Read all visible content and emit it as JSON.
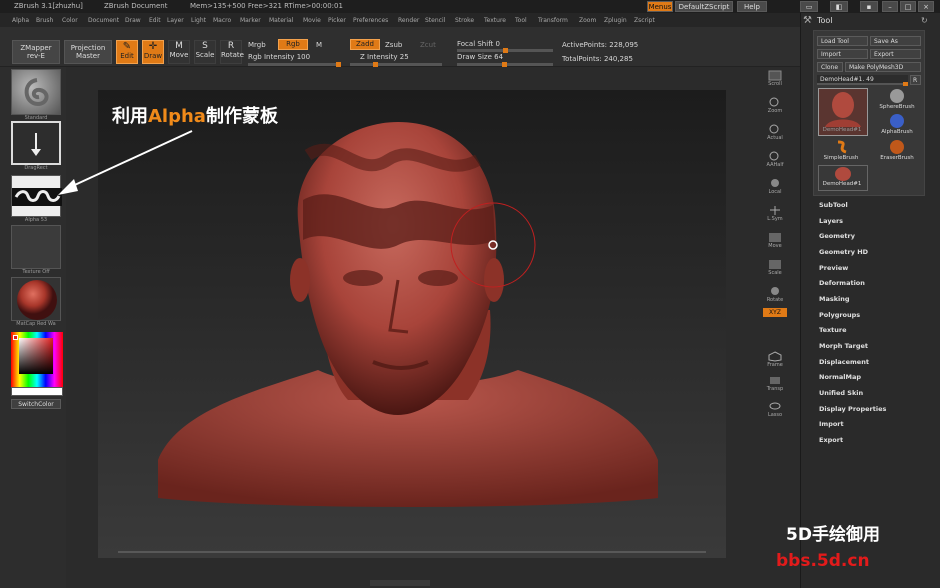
{
  "titlebar": {
    "app": "ZBrush 3.1[zhuzhu]",
    "document": "ZBrush Document",
    "stats": "Mem>135+500 Free>321 RTime>00:00:01",
    "menus_btn": "Menus",
    "script_btn": "DefaultZScript",
    "help_btn": "Help"
  },
  "menubar": [
    "Alpha",
    "Brush",
    "Color",
    "Document",
    "Draw",
    "Edit",
    "Layer",
    "Light",
    "Macro",
    "Marker",
    "Material",
    "Movie",
    "Picker",
    "Preferences",
    "Render",
    "Stencil",
    "Stroke",
    "Texture",
    "Tool",
    "Transform",
    "Zoom",
    "Zplugin",
    "Zscript"
  ],
  "shelf": {
    "zmapper": "ZMapper",
    "zmapper_sub": "rev-E",
    "projection": "Projection",
    "projection_sub": "Master",
    "edit": "Edit",
    "draw": "Draw",
    "move": "Move",
    "scale": "Scale",
    "rotate": "Rotate",
    "mrgb": "Mrgb",
    "rgb": "Rgb",
    "m": "M",
    "rgb_intensity_label": "Rgb Intensity",
    "rgb_intensity": "100",
    "zadd": "Zadd",
    "zsub": "Zsub",
    "zcut": "Zcut",
    "z_intensity_label": "Z Intensity",
    "z_intensity": "25",
    "focal_shift_label": "Focal Shift",
    "focal_shift": "0",
    "draw_size_label": "Draw Size",
    "draw_size": "64",
    "active_points_label": "ActivePoints:",
    "active_points": "228,095",
    "total_points_label": "TotalPoints:",
    "total_points": "240,285"
  },
  "leftpanel": {
    "standard": "Standard",
    "dragrect": "DragRect",
    "alpha": "Alpha 53",
    "texture": "Texture Off",
    "material": "MatCap Red Wa",
    "switchcolor": "SwitchColor"
  },
  "righttools": [
    "Scroll",
    "Zoom",
    "Actual",
    "AAHalf",
    "Local",
    "L.Sym",
    "Move",
    "Scale",
    "Rotate",
    "XYZ",
    "Frame",
    "Transp",
    "Lasso"
  ],
  "toolpanel": {
    "title": "Tool",
    "load_tool": "Load Tool",
    "save_as": "Save As",
    "import": "Import",
    "export": "Export",
    "clone": "Clone",
    "make_polymesh": "Make PolyMesh3D",
    "slider_label": "DemoHead#1. 49",
    "r": "R",
    "brushes": [
      "DemoHead#1",
      "SphereBrush",
      "AlphaBrush",
      "SimpleBrush",
      "EraserBrush",
      "DemoHead#1"
    ],
    "sections": [
      "SubTool",
      "Layers",
      "Geometry",
      "Geometry HD",
      "Preview",
      "Deformation",
      "Masking",
      "Polygroups",
      "Texture",
      "Morph Target",
      "Displacement",
      "NormalMap",
      "Unified Skin",
      "Display Properties",
      "Import",
      "Export"
    ]
  },
  "annotation": {
    "prefix": "利用",
    "highlight": "Alpha",
    "suffix": "制作蒙板"
  },
  "watermark": {
    "line1": "5D手绘御用",
    "line2": "bbs.5d.cn"
  },
  "colors": {
    "accent": "#e07a16",
    "head": "#a8443a",
    "watermark_red": "#e21b1b"
  }
}
